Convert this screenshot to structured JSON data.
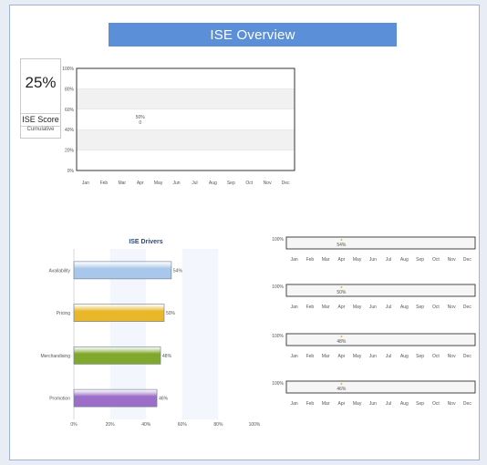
{
  "header": {
    "title": "ISE Overview"
  },
  "score": {
    "value": "25%",
    "label": "ISE Score",
    "sublabel": "Cumulative"
  },
  "colors": {
    "banner": "#5b8fd8",
    "availability": "#a9c7ea",
    "pricing": "#e8b82a",
    "merchandising": "#7fa82c",
    "promotion": "#9c6ec8"
  },
  "chart_data": [
    {
      "type": "line",
      "x": [
        "Jan",
        "Feb",
        "Mar",
        "Apr",
        "May",
        "Jun",
        "Jul",
        "Aug",
        "Sep",
        "Oct",
        "Nov",
        "Dec"
      ],
      "ylim": [
        0,
        100
      ],
      "yticks": [
        "0%",
        "20%",
        "40%",
        "60%",
        "80%",
        "100%"
      ],
      "series": [
        {
          "points": [
            {
              "x": "Apr",
              "y": 50,
              "label": "50%",
              "count": "0"
            }
          ]
        }
      ],
      "grid": true
    },
    {
      "type": "bar",
      "title": "ISE Drivers",
      "orientation": "horizontal",
      "categories": [
        "Availability",
        "Pricing",
        "Merchandising",
        "Promotion"
      ],
      "values": [
        54,
        50,
        48,
        46
      ],
      "value_labels": [
        "54%",
        "50%",
        "48%",
        "46%"
      ],
      "xlim": [
        0,
        100
      ],
      "xticks": [
        "0%",
        "20%",
        "40%",
        "60%",
        "80%",
        "100%"
      ]
    },
    {
      "type": "line",
      "x": [
        "Jan",
        "Feb",
        "Mar",
        "Apr",
        "May",
        "Jun",
        "Jul",
        "Aug",
        "Sep",
        "Oct",
        "Nov",
        "Dec"
      ],
      "ymax_label": "100%",
      "series": [
        {
          "points": [
            {
              "x": "Apr",
              "label": "54%"
            }
          ]
        }
      ]
    },
    {
      "type": "line",
      "x": [
        "Jan",
        "Feb",
        "Mar",
        "Apr",
        "May",
        "Jun",
        "Jul",
        "Aug",
        "Sep",
        "Oct",
        "Nov",
        "Dec"
      ],
      "ymax_label": "100%",
      "series": [
        {
          "points": [
            {
              "x": "Apr",
              "label": "50%"
            }
          ]
        }
      ]
    },
    {
      "type": "line",
      "x": [
        "Jan",
        "Feb",
        "Mar",
        "Apr",
        "May",
        "Jun",
        "Jul",
        "Aug",
        "Sep",
        "Oct",
        "Nov",
        "Dec"
      ],
      "ymax_label": "100%",
      "series": [
        {
          "points": [
            {
              "x": "Apr",
              "label": "48%"
            }
          ]
        }
      ]
    },
    {
      "type": "line",
      "x": [
        "Jan",
        "Feb",
        "Mar",
        "Apr",
        "May",
        "Jun",
        "Jul",
        "Aug",
        "Sep",
        "Oct",
        "Nov",
        "Dec"
      ],
      "ymax_label": "100%",
      "series": [
        {
          "points": [
            {
              "x": "Apr",
              "label": "46%"
            }
          ]
        }
      ]
    }
  ]
}
